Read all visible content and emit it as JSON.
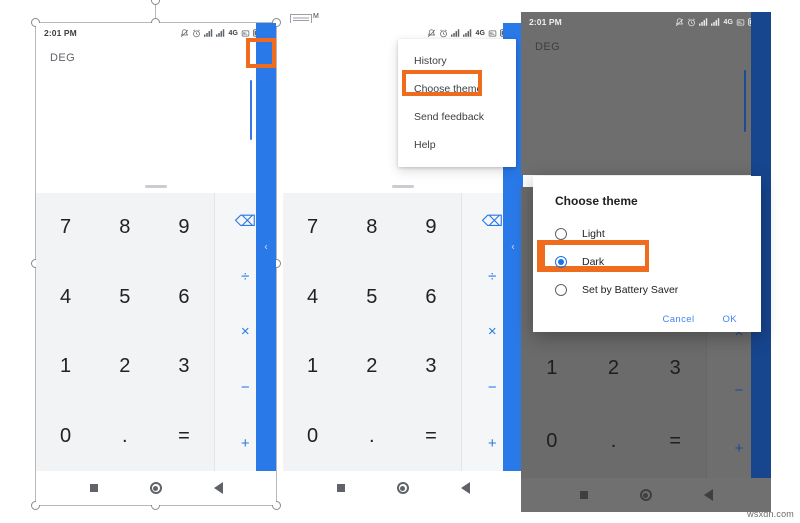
{
  "statusbar": {
    "time": "2:01 PM",
    "network": "4G",
    "icons": [
      "silent-bell-icon",
      "alarm-clock-icon",
      "signal-1-icon",
      "signal-2-icon",
      "volte-icon",
      "battery-icon"
    ]
  },
  "appbar": {
    "angle_unit": "DEG",
    "overflow_icon": "kebab-menu-icon"
  },
  "keypad": {
    "digits": [
      "7",
      "8",
      "9",
      "4",
      "5",
      "6",
      "1",
      "2",
      "3",
      "0",
      ".",
      "="
    ],
    "operators": [
      "⌫",
      "÷",
      "×",
      "−",
      "+"
    ],
    "operator_names": [
      "backspace-key",
      "divide-key",
      "multiply-key",
      "minus-key",
      "plus-key"
    ],
    "expand_chevron": "‹"
  },
  "navbar": {
    "recents": "recents-square-icon",
    "home": "home-circle-icon",
    "back": "back-triangle-icon"
  },
  "overflow_menu": {
    "items": [
      {
        "label": "History",
        "name": "menu-item-history",
        "highlighted": false
      },
      {
        "label": "Choose theme",
        "name": "menu-item-choose-theme",
        "highlighted": true
      },
      {
        "label": "Send feedback",
        "name": "menu-item-send-feedback",
        "highlighted": false
      },
      {
        "label": "Help",
        "name": "menu-item-help",
        "highlighted": false
      }
    ]
  },
  "theme_dialog": {
    "title": "Choose theme",
    "options": [
      {
        "label": "Light",
        "selected": false,
        "highlighted": false
      },
      {
        "label": "Dark",
        "selected": true,
        "highlighted": true
      },
      {
        "label": "Set by Battery Saver",
        "selected": false,
        "highlighted": false
      }
    ],
    "cancel": "Cancel",
    "ok": "OK"
  },
  "thumbnail": {
    "label": "DEG",
    "superscript": "M"
  },
  "watermark": "wsxdn.com",
  "colors": {
    "accent_blue": "#2979e8",
    "link_blue": "#4285f4",
    "highlight_orange": "#ef6c1f",
    "light_keypad": "#f2f3f5",
    "scrim_grey": "#6e6e6e"
  }
}
